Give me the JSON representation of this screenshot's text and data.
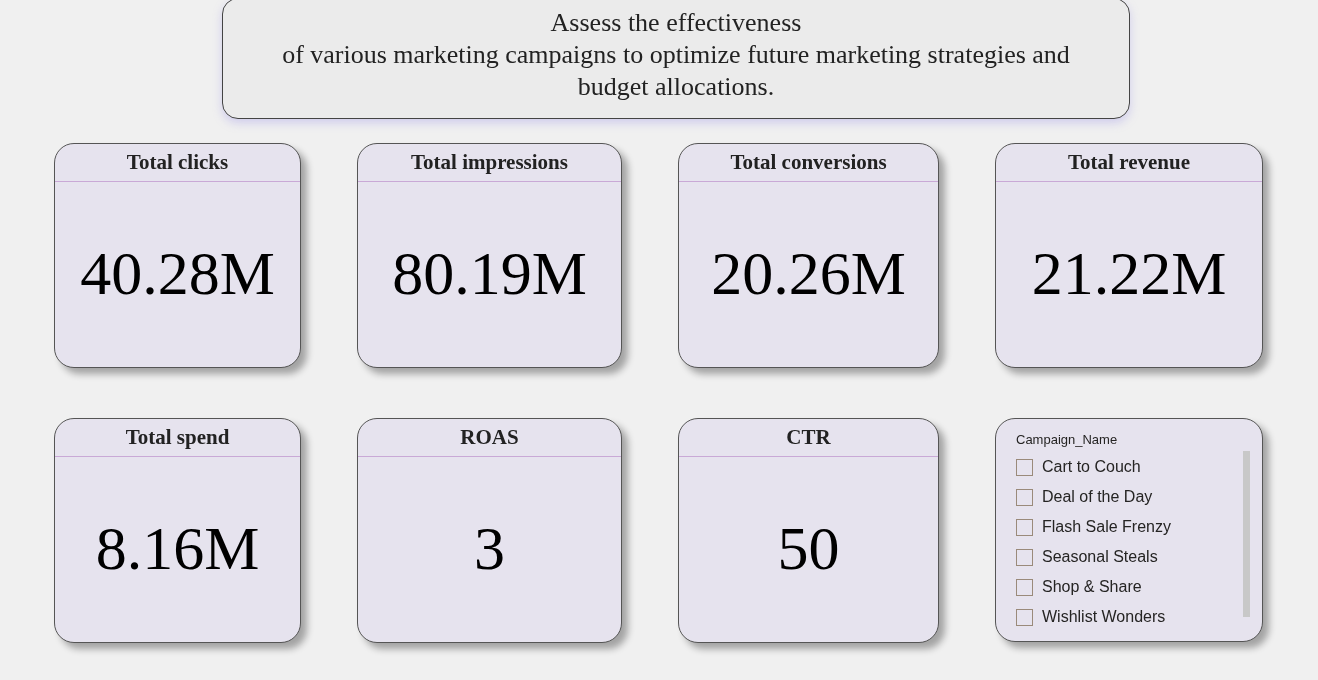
{
  "header": {
    "lines": [
      "Assess the effectiveness",
      "of various marketing campaigns to optimize future marketing strategies and budget allocations."
    ]
  },
  "cards": [
    {
      "title": "Total clicks",
      "value": "40.28M"
    },
    {
      "title": "Total impressions",
      "value": "80.19M"
    },
    {
      "title": "Total conversions",
      "value": "20.26M"
    },
    {
      "title": "Total revenue",
      "value": "21.22M"
    },
    {
      "title": "Total spend",
      "value": "8.16M"
    },
    {
      "title": "ROAS",
      "value": "3"
    },
    {
      "title": "CTR",
      "value": "50"
    }
  ],
  "slicer": {
    "title": "Campaign_Name",
    "items": [
      {
        "label": "Cart to Couch",
        "checked": false
      },
      {
        "label": "Deal of the Day",
        "checked": false
      },
      {
        "label": "Flash Sale Frenzy",
        "checked": false
      },
      {
        "label": "Seasonal Steals",
        "checked": false
      },
      {
        "label": "Shop & Share",
        "checked": false
      },
      {
        "label": "Wishlist Wonders",
        "checked": false
      }
    ]
  }
}
